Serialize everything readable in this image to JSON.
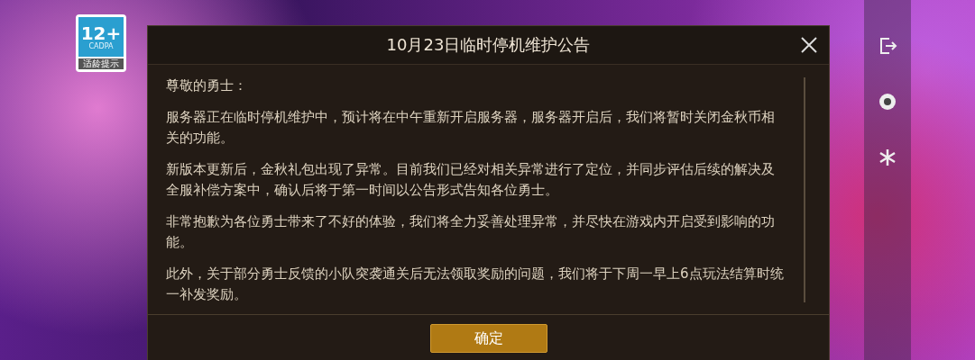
{
  "age_badge": {
    "rating": "12+",
    "org": "CADPA",
    "caption": "适龄提示"
  },
  "dialog": {
    "title": "10月23日临时停机维护公告",
    "paragraphs": [
      "尊敬的勇士：",
      "服务器正在临时停机维护中，预计将在中午重新开启服务器，服务器开启后，我们将暂时关闭金秋币相关的功能。",
      "新版本更新后，金秋礼包出现了异常。目前我们已经对相关异常进行了定位，并同步评估后续的解决及全服补偿方案中，确认后将于第一时间以公告形式告知各位勇士。",
      "非常抱歉为各位勇士带来了不好的体验，我们将全力妥善处理异常，并尽快在游戏内开启受到影响的功能。",
      "此外，关于部分勇士反馈的小队突袭通关后无法领取奖励的问题，我们将于下周一早上6点玩法结算时统一补发奖励。"
    ],
    "confirm_button": "确定"
  },
  "side_menu": [
    {
      "kind": "exit"
    },
    {
      "kind": "circle"
    },
    {
      "kind": "star"
    }
  ]
}
